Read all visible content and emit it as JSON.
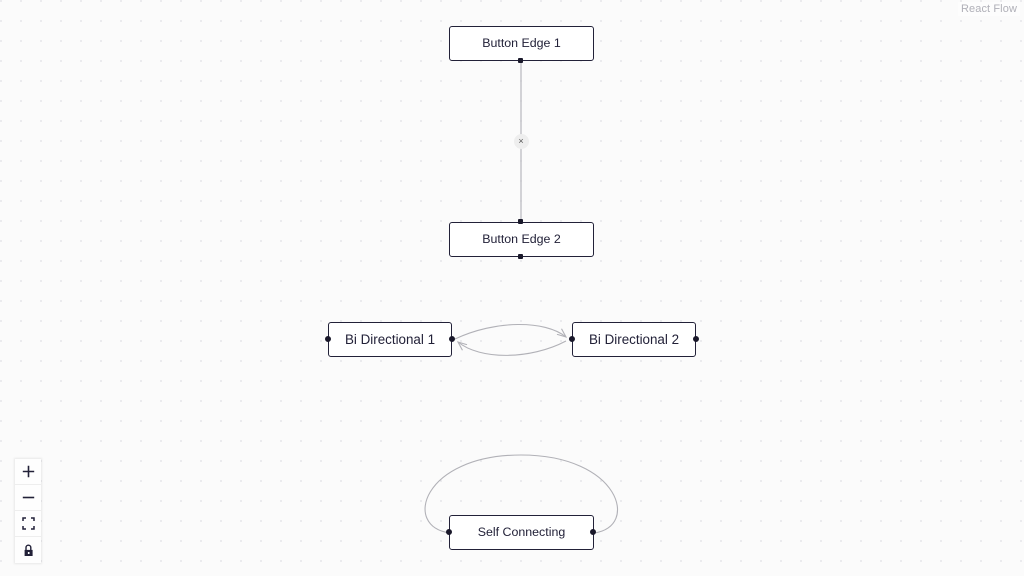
{
  "app": {
    "attribution": "React Flow"
  },
  "nodes": [
    {
      "id": "button-edge-1",
      "label": "Button Edge 1"
    },
    {
      "id": "button-edge-2",
      "label": "Button Edge 2"
    },
    {
      "id": "bi-directional-1",
      "label": "Bi Directional 1"
    },
    {
      "id": "bi-directional-2",
      "label": "Bi Directional 2"
    },
    {
      "id": "self-connecting",
      "label": "Self Connecting"
    }
  ],
  "edges": {
    "button_edge": {
      "button_label": "×",
      "color": "#b1b1b7"
    },
    "bidirectional": {
      "color": "#b1b1b7"
    },
    "self_connecting": {
      "color": "#b1b1b7"
    }
  },
  "controls": {
    "zoom_in": {
      "label": "zoom in",
      "icon": "plus-icon"
    },
    "zoom_out": {
      "label": "zoom out",
      "icon": "minus-icon"
    },
    "fit_view": {
      "label": "fit view",
      "icon": "fit-view-icon"
    },
    "lock": {
      "label": "toggle interactivity",
      "icon": "lock-icon"
    }
  },
  "colors": {
    "node_border": "#222138",
    "node_text": "#222138",
    "handle": "#1a192b",
    "edge": "#b1b1b7",
    "background": "#fbfbfb",
    "dot": "#e6e6ea",
    "attribution_text": "#b0b0b8"
  }
}
